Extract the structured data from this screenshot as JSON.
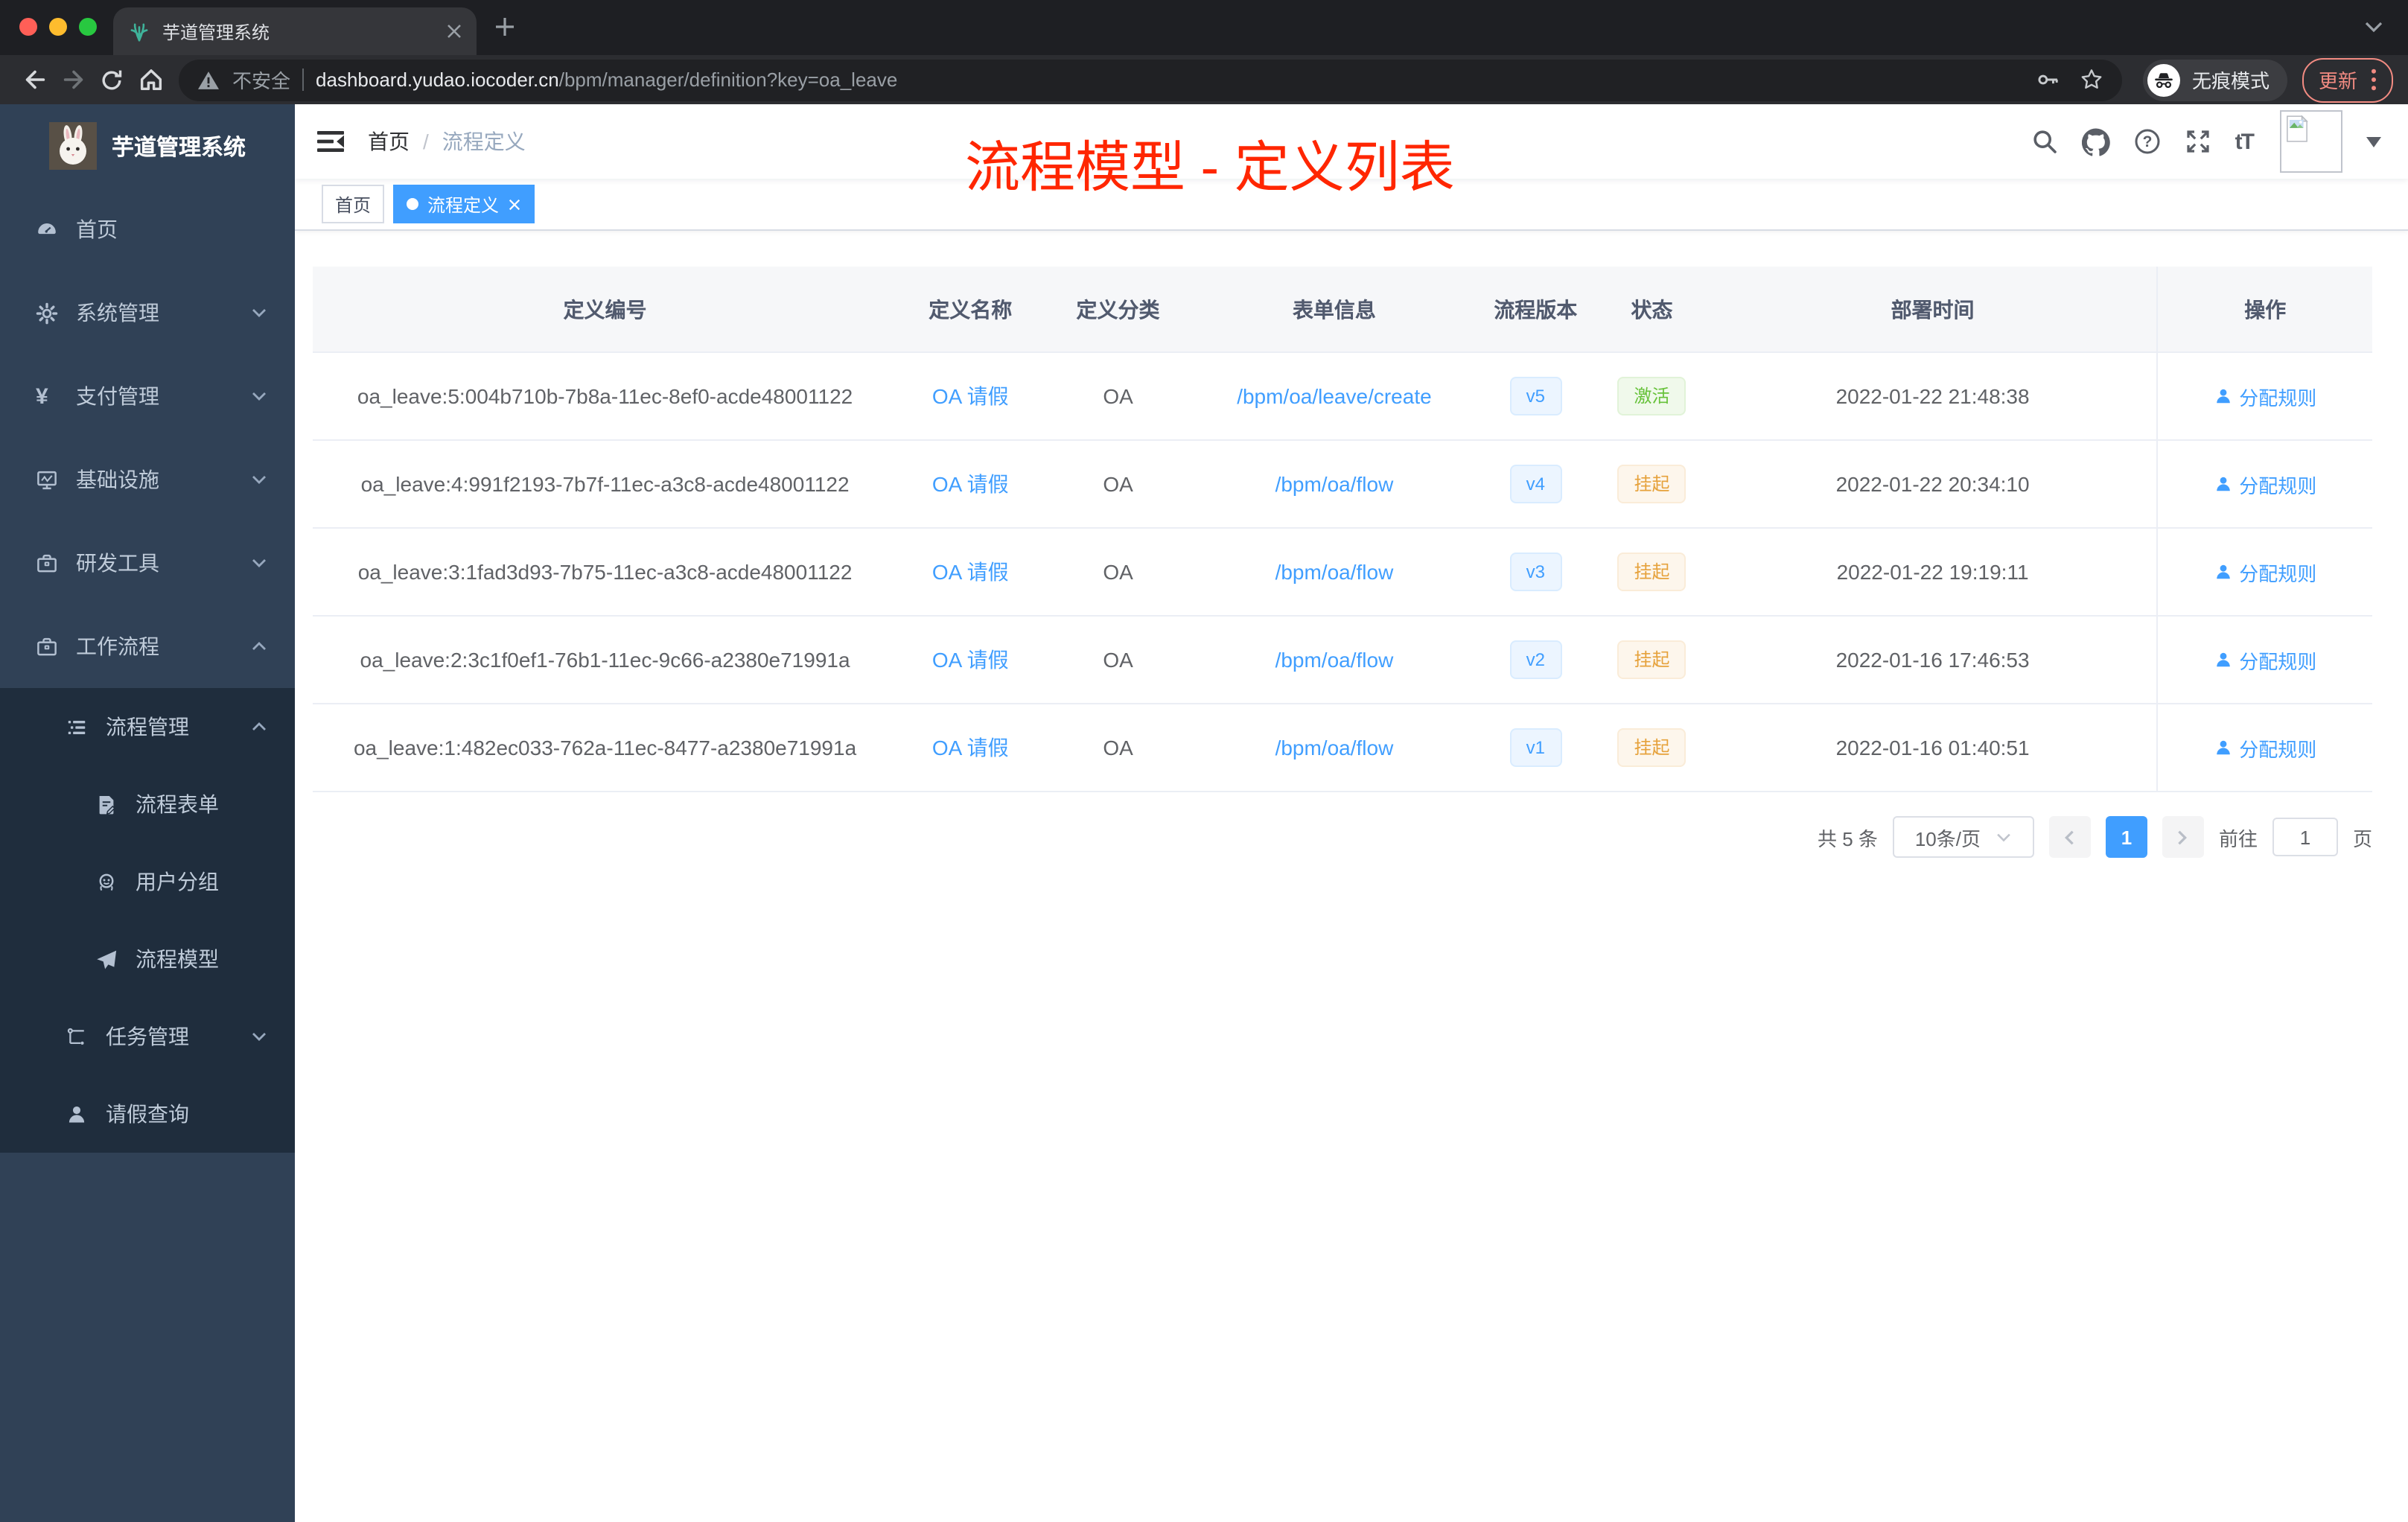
{
  "browser": {
    "tab_title": "芋道管理系统",
    "security_label": "不安全",
    "url_host": "dashboard.yudao.iocoder.cn",
    "url_path": "/bpm/manager/definition?key=oa_leave",
    "incognito_label": "无痕模式",
    "update_label": "更新"
  },
  "sidebar": {
    "logo_title": "芋道管理系统",
    "items": [
      {
        "key": "home",
        "label": "首页",
        "icon": "dashboard-icon",
        "level": 1,
        "dark": false,
        "chevron": null
      },
      {
        "key": "system",
        "label": "系统管理",
        "icon": "gear-icon",
        "level": 1,
        "dark": false,
        "chevron": "down"
      },
      {
        "key": "payment",
        "label": "支付管理",
        "icon": "yen-icon",
        "level": 1,
        "dark": false,
        "chevron": "down"
      },
      {
        "key": "infrastructure",
        "label": "基础设施",
        "icon": "monitor-icon",
        "level": 1,
        "dark": false,
        "chevron": "down"
      },
      {
        "key": "dev-tools",
        "label": "研发工具",
        "icon": "toolbox-icon",
        "level": 1,
        "dark": false,
        "chevron": "down"
      },
      {
        "key": "workflow",
        "label": "工作流程",
        "icon": "briefcase-icon",
        "level": 1,
        "dark": false,
        "chevron": "up"
      },
      {
        "key": "process-management",
        "label": "流程管理",
        "icon": "list-icon",
        "level": 2,
        "dark": true,
        "chevron": "up"
      },
      {
        "key": "process-form",
        "label": "流程表单",
        "icon": "form-icon",
        "level": 3,
        "dark": true,
        "chevron": null
      },
      {
        "key": "user-group",
        "label": "用户分组",
        "icon": "user-group-icon",
        "level": 3,
        "dark": true,
        "chevron": null
      },
      {
        "key": "process-model",
        "label": "流程模型",
        "icon": "paper-plane-icon",
        "level": 3,
        "dark": true,
        "chevron": null
      },
      {
        "key": "task-management",
        "label": "任务管理",
        "icon": "tree-icon",
        "level": 2,
        "dark": true,
        "chevron": "down"
      },
      {
        "key": "leave-query",
        "label": "请假查询",
        "icon": "person-icon",
        "level": 2,
        "dark": true,
        "chevron": null
      }
    ]
  },
  "navbar": {
    "breadcrumb": [
      "首页",
      "流程定义"
    ],
    "annotation": "流程模型 - 定义列表"
  },
  "tags": [
    {
      "label": "首页",
      "active": false,
      "closable": false
    },
    {
      "label": "流程定义",
      "active": true,
      "closable": true
    }
  ],
  "table": {
    "headers": [
      "定义编号",
      "定义名称",
      "定义分类",
      "表单信息",
      "流程版本",
      "状态",
      "部署时间",
      "操作"
    ],
    "rows": [
      {
        "id": "oa_leave:5:004b710b-7b8a-11ec-8ef0-acde48001122",
        "name": "OA 请假",
        "category": "OA",
        "form": "/bpm/oa/leave/create",
        "version": "v5",
        "status": "激活",
        "status_type": "success",
        "deploy_time": "2022-01-22 21:48:38",
        "action": "分配规则"
      },
      {
        "id": "oa_leave:4:991f2193-7b7f-11ec-a3c8-acde48001122",
        "name": "OA 请假",
        "category": "OA",
        "form": "/bpm/oa/flow",
        "version": "v4",
        "status": "挂起",
        "status_type": "warning",
        "deploy_time": "2022-01-22 20:34:10",
        "action": "分配规则"
      },
      {
        "id": "oa_leave:3:1fad3d93-7b75-11ec-a3c8-acde48001122",
        "name": "OA 请假",
        "category": "OA",
        "form": "/bpm/oa/flow",
        "version": "v3",
        "status": "挂起",
        "status_type": "warning",
        "deploy_time": "2022-01-22 19:19:11",
        "action": "分配规则"
      },
      {
        "id": "oa_leave:2:3c1f0ef1-76b1-11ec-9c66-a2380e71991a",
        "name": "OA 请假",
        "category": "OA",
        "form": "/bpm/oa/flow",
        "version": "v2",
        "status": "挂起",
        "status_type": "warning",
        "deploy_time": "2022-01-16 17:46:53",
        "action": "分配规则"
      },
      {
        "id": "oa_leave:1:482ec033-762a-11ec-8477-a2380e71991a",
        "name": "OA 请假",
        "category": "OA",
        "form": "/bpm/oa/flow",
        "version": "v1",
        "status": "挂起",
        "status_type": "warning",
        "deploy_time": "2022-01-16 01:40:51",
        "action": "分配规则"
      }
    ]
  },
  "pagination": {
    "total_label": "共 5 条",
    "page_size": "10条/页",
    "current_page": "1",
    "goto_label": "前往",
    "goto_value": "1",
    "page_unit": "页"
  },
  "colors": {
    "accent": "#409eff",
    "sidebar_bg": "#304156",
    "submenu_bg": "#1f2d3d",
    "success": "#67c23a",
    "warning": "#e6a23c",
    "annotation_red": "#ff2600",
    "active_tag": "#409eff"
  }
}
